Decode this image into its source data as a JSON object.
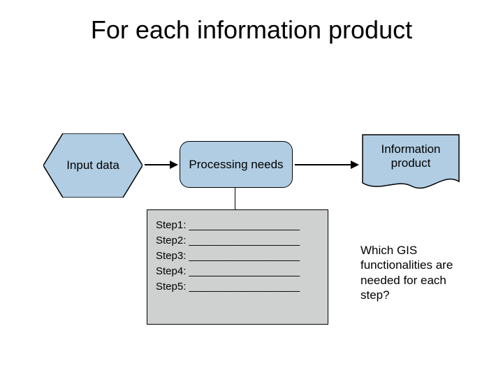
{
  "title": "For each information product",
  "nodes": {
    "input": "Input data",
    "processing": "Processing needs",
    "output_line1": "Information",
    "output_line2": "product"
  },
  "steps_box": {
    "lines": [
      "Step1: ___________________",
      "Step2: ___________________",
      "Step3: ___________________",
      "Step4: ___________________",
      "Step5: ___________________"
    ]
  },
  "question": "Which GIS functionalities are needed for each step?",
  "colors": {
    "node_fill": "#b0cde3",
    "steps_fill": "#cfd1d0"
  }
}
